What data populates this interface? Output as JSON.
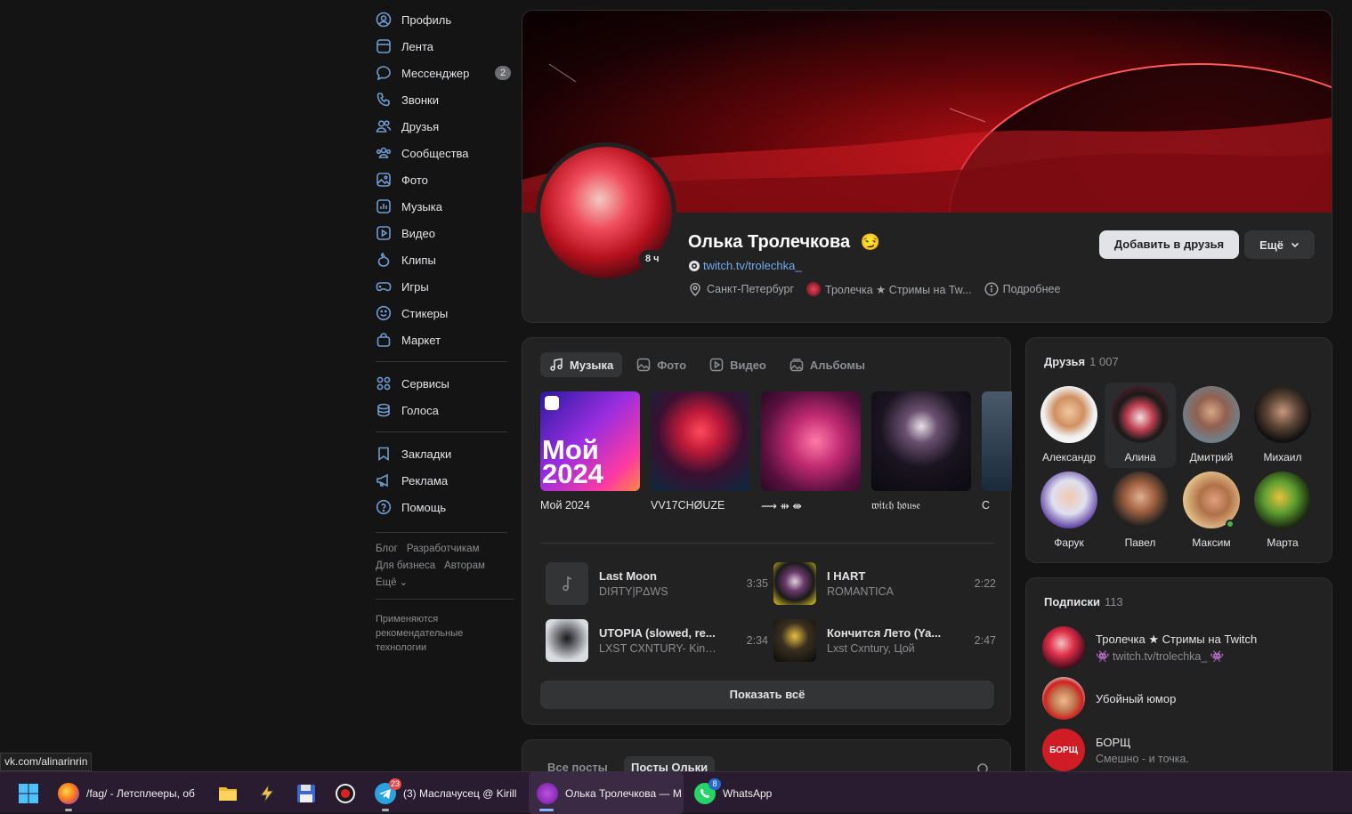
{
  "nav": {
    "items": [
      {
        "label": "Профиль",
        "icon": "user-circle-icon"
      },
      {
        "label": "Лента",
        "icon": "feed-icon"
      },
      {
        "label": "Мессенджер",
        "icon": "message-icon",
        "badge": "2"
      },
      {
        "label": "Звонки",
        "icon": "phone-icon"
      },
      {
        "label": "Друзья",
        "icon": "users-icon"
      },
      {
        "label": "Сообщества",
        "icon": "groups-icon"
      },
      {
        "label": "Фото",
        "icon": "photo-icon"
      },
      {
        "label": "Музыка",
        "icon": "music-icon"
      },
      {
        "label": "Видео",
        "icon": "video-icon"
      },
      {
        "label": "Клипы",
        "icon": "clips-icon"
      },
      {
        "label": "Игры",
        "icon": "gamepad-icon"
      },
      {
        "label": "Стикеры",
        "icon": "smile-icon"
      },
      {
        "label": "Маркет",
        "icon": "bag-icon"
      }
    ],
    "items2": [
      {
        "label": "Сервисы",
        "icon": "services-icon"
      },
      {
        "label": "Голоса",
        "icon": "coins-icon"
      }
    ],
    "items3": [
      {
        "label": "Закладки",
        "icon": "bookmark-icon"
      },
      {
        "label": "Реклама",
        "icon": "megaphone-icon"
      },
      {
        "label": "Помощь",
        "icon": "help-icon"
      }
    ],
    "links": [
      "Блог",
      "Разработчикам",
      "Для бизнеса",
      "Авторам"
    ],
    "links_more": "Ещё",
    "note": "Применяются рекомендательные технологии"
  },
  "profile": {
    "name": "Олька Тролечкова",
    "online_time": "8 ч",
    "link": "twitch.tv/trolechka_",
    "city": "Санкт-Петербург",
    "community": "Тролечка ★ Стримы на Tw...",
    "details": "Подробнее",
    "add_friend": "Добавить в друзья",
    "more": "Ещё"
  },
  "media": {
    "tabs": [
      "Музыка",
      "Фото",
      "Видео",
      "Альбомы"
    ],
    "albums": [
      {
        "title": "Мой 2024",
        "cover_text": "Мой 2024"
      },
      {
        "title": "VV17CHØUZE"
      },
      {
        "title": "⟿ ⇻ ⇼"
      },
      {
        "title": "𝔴𝔦𝔱𝔠𝔥 𝔥𝔬𝔲𝔰𝔢"
      },
      {
        "title": "С"
      }
    ],
    "tracks": [
      {
        "title": "Last Moon",
        "artist": "DIЯTY|PΔWS",
        "duration": "3:35"
      },
      {
        "title": "I HART",
        "artist": "ROMANTICA",
        "duration": "2:22"
      },
      {
        "title": "UTOPIA (slowed, re...",
        "artist": "LXST CXNTURY- King...",
        "duration": "2:34"
      },
      {
        "title": "Кончится Лето (Ya...",
        "artist": "Lxst Cxntury, Цой",
        "duration": "2:47"
      }
    ],
    "show_all": "Показать всё"
  },
  "posts": {
    "tab_all": "Все посты",
    "tab_own": "Посты Ольки"
  },
  "friends": {
    "title": "Друзья",
    "count": "1 007",
    "list": [
      {
        "name": "Александр"
      },
      {
        "name": "Алина"
      },
      {
        "name": "Дмитрий"
      },
      {
        "name": "Михаил"
      },
      {
        "name": "Фарук"
      },
      {
        "name": "Павел"
      },
      {
        "name": "Максим"
      },
      {
        "name": "Марта"
      }
    ]
  },
  "subs": {
    "title": "Подписки",
    "count": "113",
    "list": [
      {
        "name": "Тролечка ★ Стримы на Twitch",
        "desc": "👾 twitch.tv/trolechka_ 👾"
      },
      {
        "name": "Убойный юмор",
        "desc": ""
      },
      {
        "name": "БОРЩ",
        "desc": "Смешно - и точка.",
        "avatar_text": "БОРЩ"
      }
    ]
  },
  "status_url": "vk.com/alinarinrin",
  "taskbar": {
    "firefox": "/fag/ - Летсплееры, об",
    "telegram": "(3) Маслачусец @ Kirill",
    "telegram_badge": "23",
    "vk": "Олька Тролечкова — М",
    "whatsapp": "WhatsApp",
    "whatsapp_badge": "8"
  },
  "colors": {
    "background": "#141414",
    "card": "#222222",
    "accent_link": "#71aaeb",
    "icon_blue": "#6e9ccf",
    "taskbar": "#2a1c30"
  }
}
